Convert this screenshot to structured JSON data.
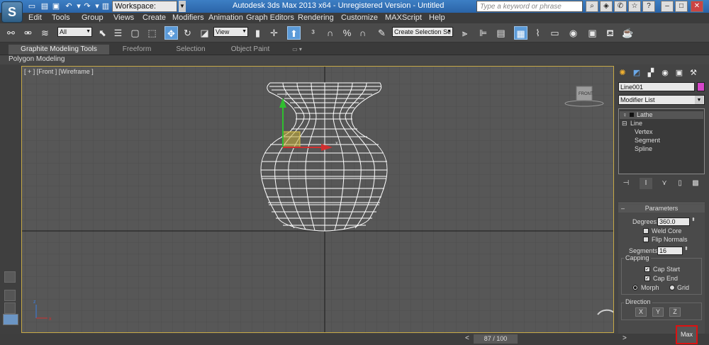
{
  "titlebar": {
    "app_logo": "S",
    "workspace": "Workspace: Default",
    "title": "Autodesk 3ds Max  2013 x64    -   Unregistered Version  -  Untitled",
    "search_placeholder": "Type a keyword or phrase"
  },
  "menu": [
    "Edit",
    "Tools",
    "Group",
    "Views",
    "Create",
    "Modifiers",
    "Animation",
    "Graph Editors",
    "Rendering",
    "Customize",
    "MAXScript",
    "Help"
  ],
  "toolbar": {
    "selection_filter": "All",
    "ref_coord": "View",
    "named_selection": "Create Selection Se"
  },
  "ribbon": {
    "tabs": [
      "Graphite Modeling Tools",
      "Freeform",
      "Selection",
      "Object Paint"
    ],
    "sub_label": "Polygon Modeling"
  },
  "viewport": {
    "label": "[ + ] [Front ] [Wireframe ]",
    "viewcube_label": "FRONT"
  },
  "command_panel": {
    "object_name": "Line001",
    "object_color": "#d646c9",
    "modifier_list": "Modifier List",
    "stack": {
      "lathe": "Lathe",
      "line": "Line",
      "vertex": "Vertex",
      "segment": "Segment",
      "spline": "Spline"
    },
    "params": {
      "title": "Parameters",
      "degrees_label": "Degrees:",
      "degrees_value": "360.0",
      "weld_core": "Weld Core",
      "flip_normals": "Flip Normals",
      "segments_label": "Segments:",
      "segments_value": "16",
      "capping_label": "Capping",
      "cap_start": "Cap Start",
      "cap_end": "Cap End",
      "morph": "Morph",
      "grid": "Grid",
      "direction_label": "Direction",
      "x": "X",
      "y": "Y",
      "z": "Z"
    }
  },
  "status": {
    "time_slider": "87 / 100",
    "max_button": "Max"
  }
}
